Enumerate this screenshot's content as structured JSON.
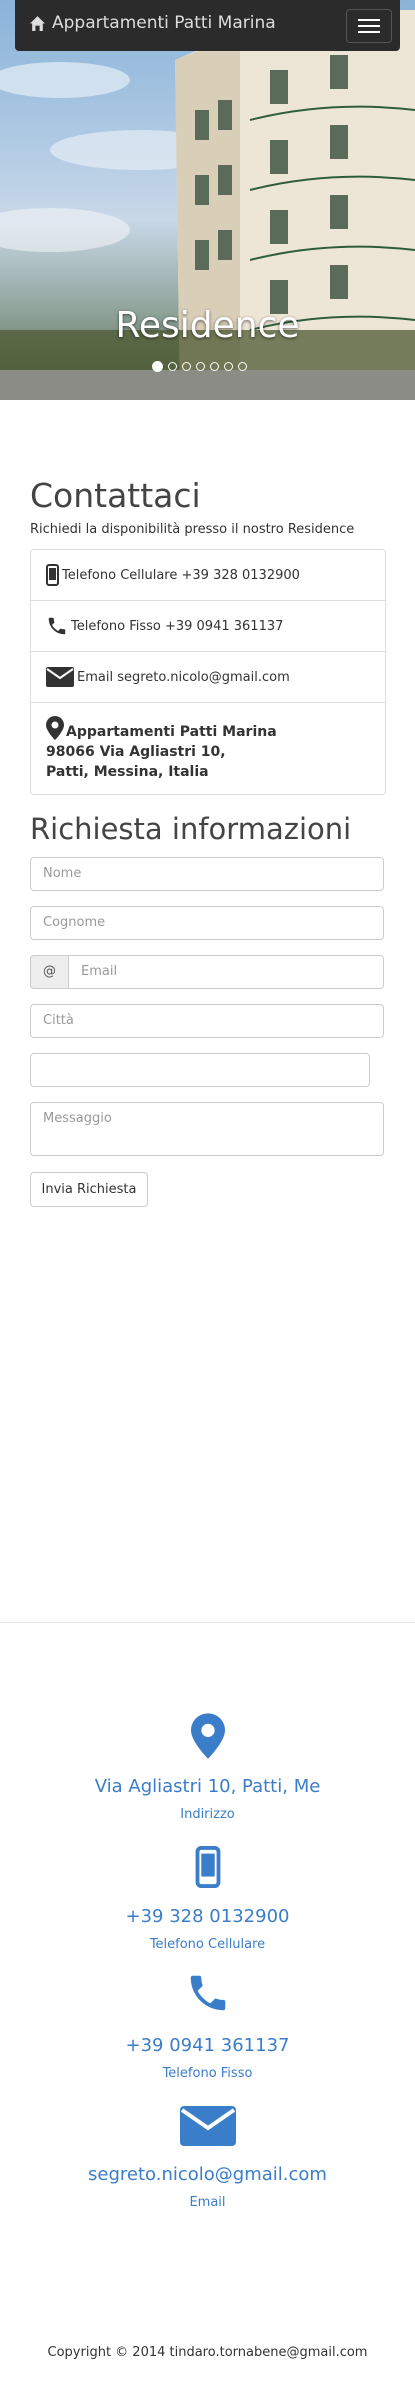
{
  "navbar": {
    "brand": "Appartamenti Patti Marina",
    "menu_label": "Toggle navigation"
  },
  "carousel": {
    "caption": "Residence",
    "slide_count": 7,
    "active_slide": 1
  },
  "contact": {
    "title": "Contattaci",
    "subtitle": "Richiedi la disponibilità presso il nostro Residence",
    "mobile": "Telefono Cellulare +39 328 0132900",
    "landline": "Telefono Fisso +39 0941 361137",
    "email": "Email segreto.nicolo@gmail.com",
    "address_lines": [
      "Appartamenti Patti Marina",
      "98066 Via Agliastri 10,",
      "Patti, Messina, Italia"
    ]
  },
  "form": {
    "title": "Richiesta informazioni",
    "nome_placeholder": "Nome",
    "cognome_placeholder": "Cognome",
    "email_addon": "@",
    "email_placeholder": "Email",
    "citta_placeholder": "Città",
    "captcha_value": "",
    "messaggio_placeholder": "Messaggio",
    "submit_label": "Invia Richiesta"
  },
  "footer_info": {
    "address_value": "Via Agliastri 10, Patti, Me",
    "address_label": "Indirizzo",
    "mobile_value": "+39 328 0132900",
    "mobile_label": "Telefono Cellulare",
    "phone_value": "+39 0941 361137",
    "phone_label": "Telefono Fisso",
    "email_value": "segreto.nicolo@gmail.com",
    "email_label": "Email"
  },
  "copyright": "Copyright © 2014 tindaro.tornabene@gmail.com",
  "colors": {
    "accent": "#3a7dc9",
    "navbar": "#2b2b2b"
  }
}
